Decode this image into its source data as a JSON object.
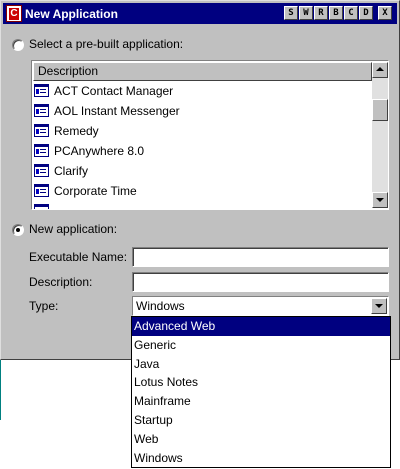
{
  "window": {
    "title": "New Application",
    "titlebar_buttons": [
      "S",
      "W",
      "R",
      "B",
      "C",
      "D",
      "X"
    ]
  },
  "prebuilt": {
    "label": "Select a pre-built application:",
    "selected": false,
    "column_header": "Description",
    "items": [
      {
        "label": "ACT Contact Manager",
        "icon": "application-icon"
      },
      {
        "label": "AOL Instant Messenger",
        "icon": "application-icon"
      },
      {
        "label": "Remedy",
        "icon": "application-icon"
      },
      {
        "label": "PCAnywhere 8.0",
        "icon": "application-icon"
      },
      {
        "label": "Clarify",
        "icon": "application-icon"
      },
      {
        "label": "Corporate Time",
        "icon": "application-icon"
      }
    ]
  },
  "new_app": {
    "label": "New application:",
    "selected": true,
    "executable_label": "Executable Name:",
    "executable_value": "",
    "description_label": "Description:",
    "description_value": "",
    "type_label": "Type:",
    "type_value": "Windows",
    "type_options": [
      "Advanced Web",
      "Generic",
      "Java",
      "Lotus Notes",
      "Mainframe",
      "Startup",
      "Web",
      "Windows"
    ],
    "highlighted_option": "Advanced Web"
  },
  "colors": {
    "titlebar": "#000080",
    "highlight": "#000080",
    "face": "#c0c0c0"
  }
}
